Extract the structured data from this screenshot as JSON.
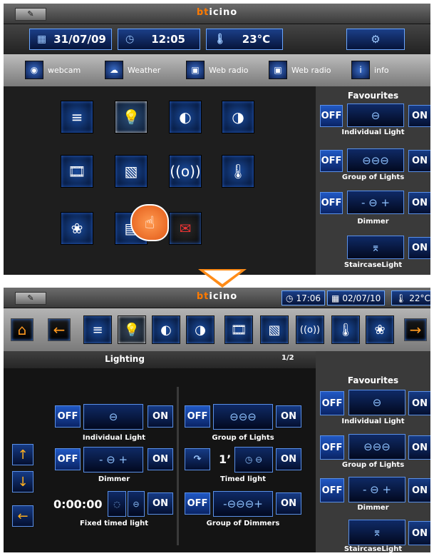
{
  "top": {
    "logo_prefix": "bt",
    "logo_rest": "icino",
    "date": "31/07/09",
    "time": "12:05",
    "temperature": "23°C",
    "links": [
      "webcam",
      "Weather",
      "Web radio",
      "Web radio",
      "info"
    ]
  },
  "favourites_top": {
    "title": "Favourites",
    "items": [
      {
        "off": "OFF",
        "on": "ON",
        "label": "Individual Light"
      },
      {
        "off": "OFF",
        "on": "ON",
        "label": "Group of Lights"
      },
      {
        "off": "OFF",
        "on": "ON",
        "label": "Dimmer"
      },
      {
        "on": "ON",
        "label": "StaircaseLight"
      }
    ]
  },
  "bottom": {
    "logo_prefix": "bt",
    "logo_rest": "icino",
    "time": "17:06",
    "date": "02/07/10",
    "temperature": "22°C",
    "section_title": "Lighting",
    "page": "1/2",
    "controls": {
      "off": "OFF",
      "on": "ON",
      "individual_light": "Individual Light",
      "group_of_lights": "Group of Lights",
      "dimmer": "Dimmer",
      "timed_light": "Timed light",
      "timed_value": "1’",
      "fixed_timer": "0:00:00",
      "fixed_timed_light": "Fixed timed light",
      "group_of_dimmers": "Group of Dimmers"
    },
    "favourites": {
      "title": "Favourites",
      "items": [
        {
          "off": "OFF",
          "on": "ON",
          "label": "Individual Light"
        },
        {
          "off": "OFF",
          "on": "ON",
          "label": "Group of Lights"
        },
        {
          "off": "OFF",
          "on": "ON",
          "label": "Dimmer"
        },
        {
          "on": "ON",
          "label": "StaircaseLight"
        }
      ]
    }
  }
}
